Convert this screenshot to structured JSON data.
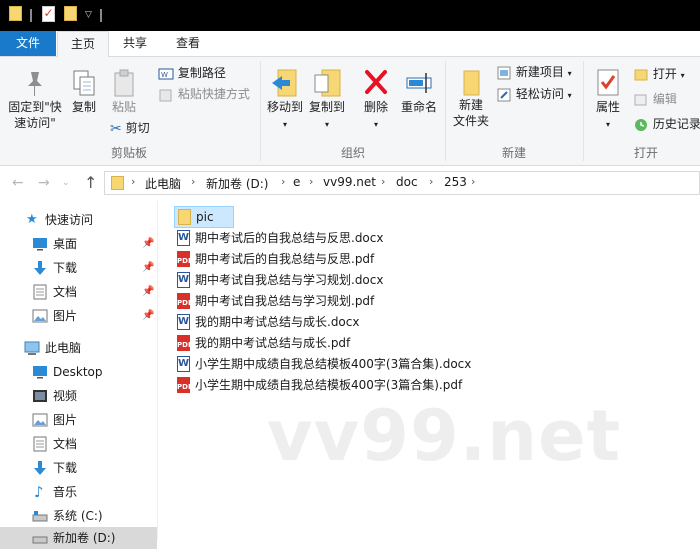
{
  "ribbon_tabs": {
    "file": "文件",
    "home": "主页",
    "share": "共享",
    "view": "查看"
  },
  "clipboard": {
    "pin_quick_access": "固定到\"快\n速访问\"",
    "pin_line1": "固定到\"快",
    "pin_line2": "速访问\"",
    "copy": "复制",
    "paste": "粘贴",
    "copy_path": "复制路径",
    "paste_shortcut": "粘贴快捷方式",
    "cut": "剪切",
    "label": "剪贴板"
  },
  "organize": {
    "move_to": "移动到",
    "copy_to": "复制到",
    "delete": "删除",
    "rename": "重命名",
    "label": "组织"
  },
  "new_group": {
    "new_folder_line1": "新建",
    "new_folder_line2": "文件夹",
    "new_item": "新建项目",
    "easy_access": "轻松访问",
    "label": "新建"
  },
  "open_group": {
    "properties": "属性",
    "open": "打开",
    "edit": "编辑",
    "history": "历史记录",
    "label": "打开"
  },
  "breadcrumb": [
    "此电脑",
    "新加卷 (D:)",
    "e",
    "vv99.net",
    "doc",
    "253"
  ],
  "sidebar": {
    "quick_access": "快速访问",
    "quick_items": [
      {
        "label": "桌面",
        "icon": "desktop-icon"
      },
      {
        "label": "下载",
        "icon": "download-icon"
      },
      {
        "label": "文档",
        "icon": "documents-icon"
      },
      {
        "label": "图片",
        "icon": "pictures-icon"
      }
    ],
    "this_pc": "此电脑",
    "pc_items": [
      {
        "label": "Desktop",
        "icon": "desktop-icon"
      },
      {
        "label": "视频",
        "icon": "videos-icon"
      },
      {
        "label": "图片",
        "icon": "pictures-icon"
      },
      {
        "label": "文档",
        "icon": "documents-icon"
      },
      {
        "label": "下载",
        "icon": "download-icon"
      },
      {
        "label": "音乐",
        "icon": "music-icon"
      },
      {
        "label": "系统 (C:)",
        "icon": "drive-icon"
      },
      {
        "label": "新加卷 (D:)",
        "icon": "drive-icon"
      }
    ]
  },
  "files": [
    {
      "name": "pic",
      "type": "folder"
    },
    {
      "name": "期中考试后的自我总结与反思.docx",
      "type": "docx"
    },
    {
      "name": "期中考试后的自我总结与反思.pdf",
      "type": "pdf"
    },
    {
      "name": "期中考试自我总结与学习规划.docx",
      "type": "docx"
    },
    {
      "name": "期中考试自我总结与学习规划.pdf",
      "type": "pdf"
    },
    {
      "name": "我的期中考试总结与成长.docx",
      "type": "docx"
    },
    {
      "name": "我的期中考试总结与成长.pdf",
      "type": "pdf"
    },
    {
      "name": "小学生期中成绩自我总结模板400字(3篇合集).docx",
      "type": "docx"
    },
    {
      "name": "小学生期中成绩自我总结模板400字(3篇合集).pdf",
      "type": "pdf"
    }
  ],
  "watermark": "vv99.net",
  "colors": {
    "accent": "#1979ca",
    "selection": "#cce8ff",
    "folder": "#f7d774",
    "pdf": "#d9302a",
    "word": "#2b579a",
    "delete": "#e81123"
  }
}
